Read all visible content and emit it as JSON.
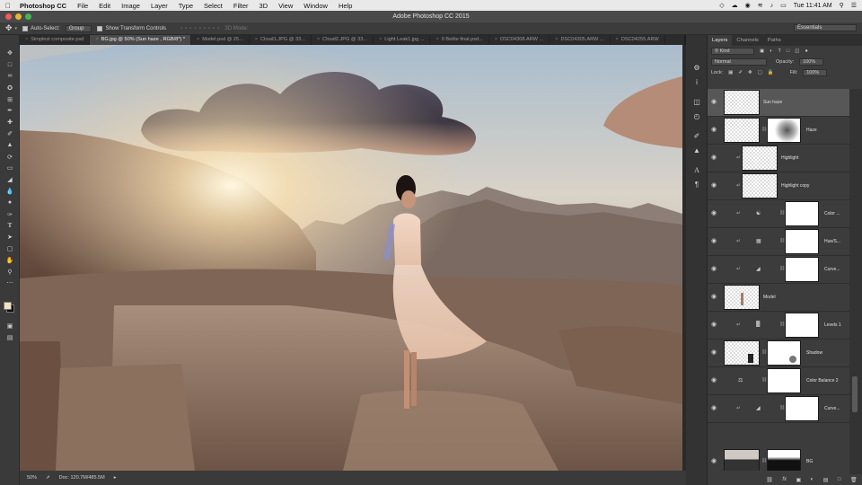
{
  "menubar": {
    "app": "Photoshop CC",
    "items": [
      "File",
      "Edit",
      "Image",
      "Layer",
      "Type",
      "Select",
      "Filter",
      "3D",
      "View",
      "Window",
      "Help"
    ],
    "clock": "Tue 11:41 AM"
  },
  "window_title": "Adobe Photoshop CC 2015",
  "options": {
    "auto_select_label": "Auto-Select:",
    "auto_select_value": "Group",
    "transform_label": "Show Transform Controls",
    "mode_3d": "3D Mode:",
    "workspace": "Essentials"
  },
  "tabs": [
    {
      "label": "Simplest composite.psd",
      "active": false
    },
    {
      "label": "BG.jpg @ 50% (Sun haze , RGB/8*) *",
      "active": true
    },
    {
      "label": "Model.psd @ 25...",
      "active": false
    },
    {
      "label": "Cloud1.JPG @ 33...",
      "active": false
    },
    {
      "label": "Cloud2.JPG @ 33...",
      "active": false
    },
    {
      "label": "Light Leak1.jpg ...",
      "active": false
    },
    {
      "label": "0 Bettie final.psd...",
      "active": false
    },
    {
      "label": "DSC04308.ARW ...",
      "active": false
    },
    {
      "label": "DSC04305.ARW ...",
      "active": false
    },
    {
      "label": "DSC04255.ARW",
      "active": false
    }
  ],
  "status": {
    "zoom": "50%",
    "doc": "Doc: 120.7M/485.5M"
  },
  "layers_panel": {
    "tabs": [
      "Layers",
      "Channels",
      "Paths"
    ],
    "filter": "Kind",
    "blend_mode": "Normal",
    "opacity_label": "Opacity:",
    "opacity": "100%",
    "lock_label": "Lock:",
    "fill_label": "Fill:",
    "fill": "100%",
    "layers": [
      {
        "name": "Sun haze",
        "selected": true
      },
      {
        "name": "Haze",
        "selected": false
      },
      {
        "name": "Highlight",
        "selected": false
      },
      {
        "name": "Highlight copy",
        "selected": false
      },
      {
        "name": "Color ...",
        "selected": false
      },
      {
        "name": "Hue/S...",
        "selected": false
      },
      {
        "name": "Curve...",
        "selected": false
      },
      {
        "name": "Model",
        "selected": false
      },
      {
        "name": "Levels 1",
        "selected": false
      },
      {
        "name": "Shadow",
        "selected": false
      },
      {
        "name": "Color Balance 2",
        "selected": false
      },
      {
        "name": "Curve...",
        "selected": false
      },
      {
        "name": "BG",
        "selected": false
      }
    ]
  }
}
